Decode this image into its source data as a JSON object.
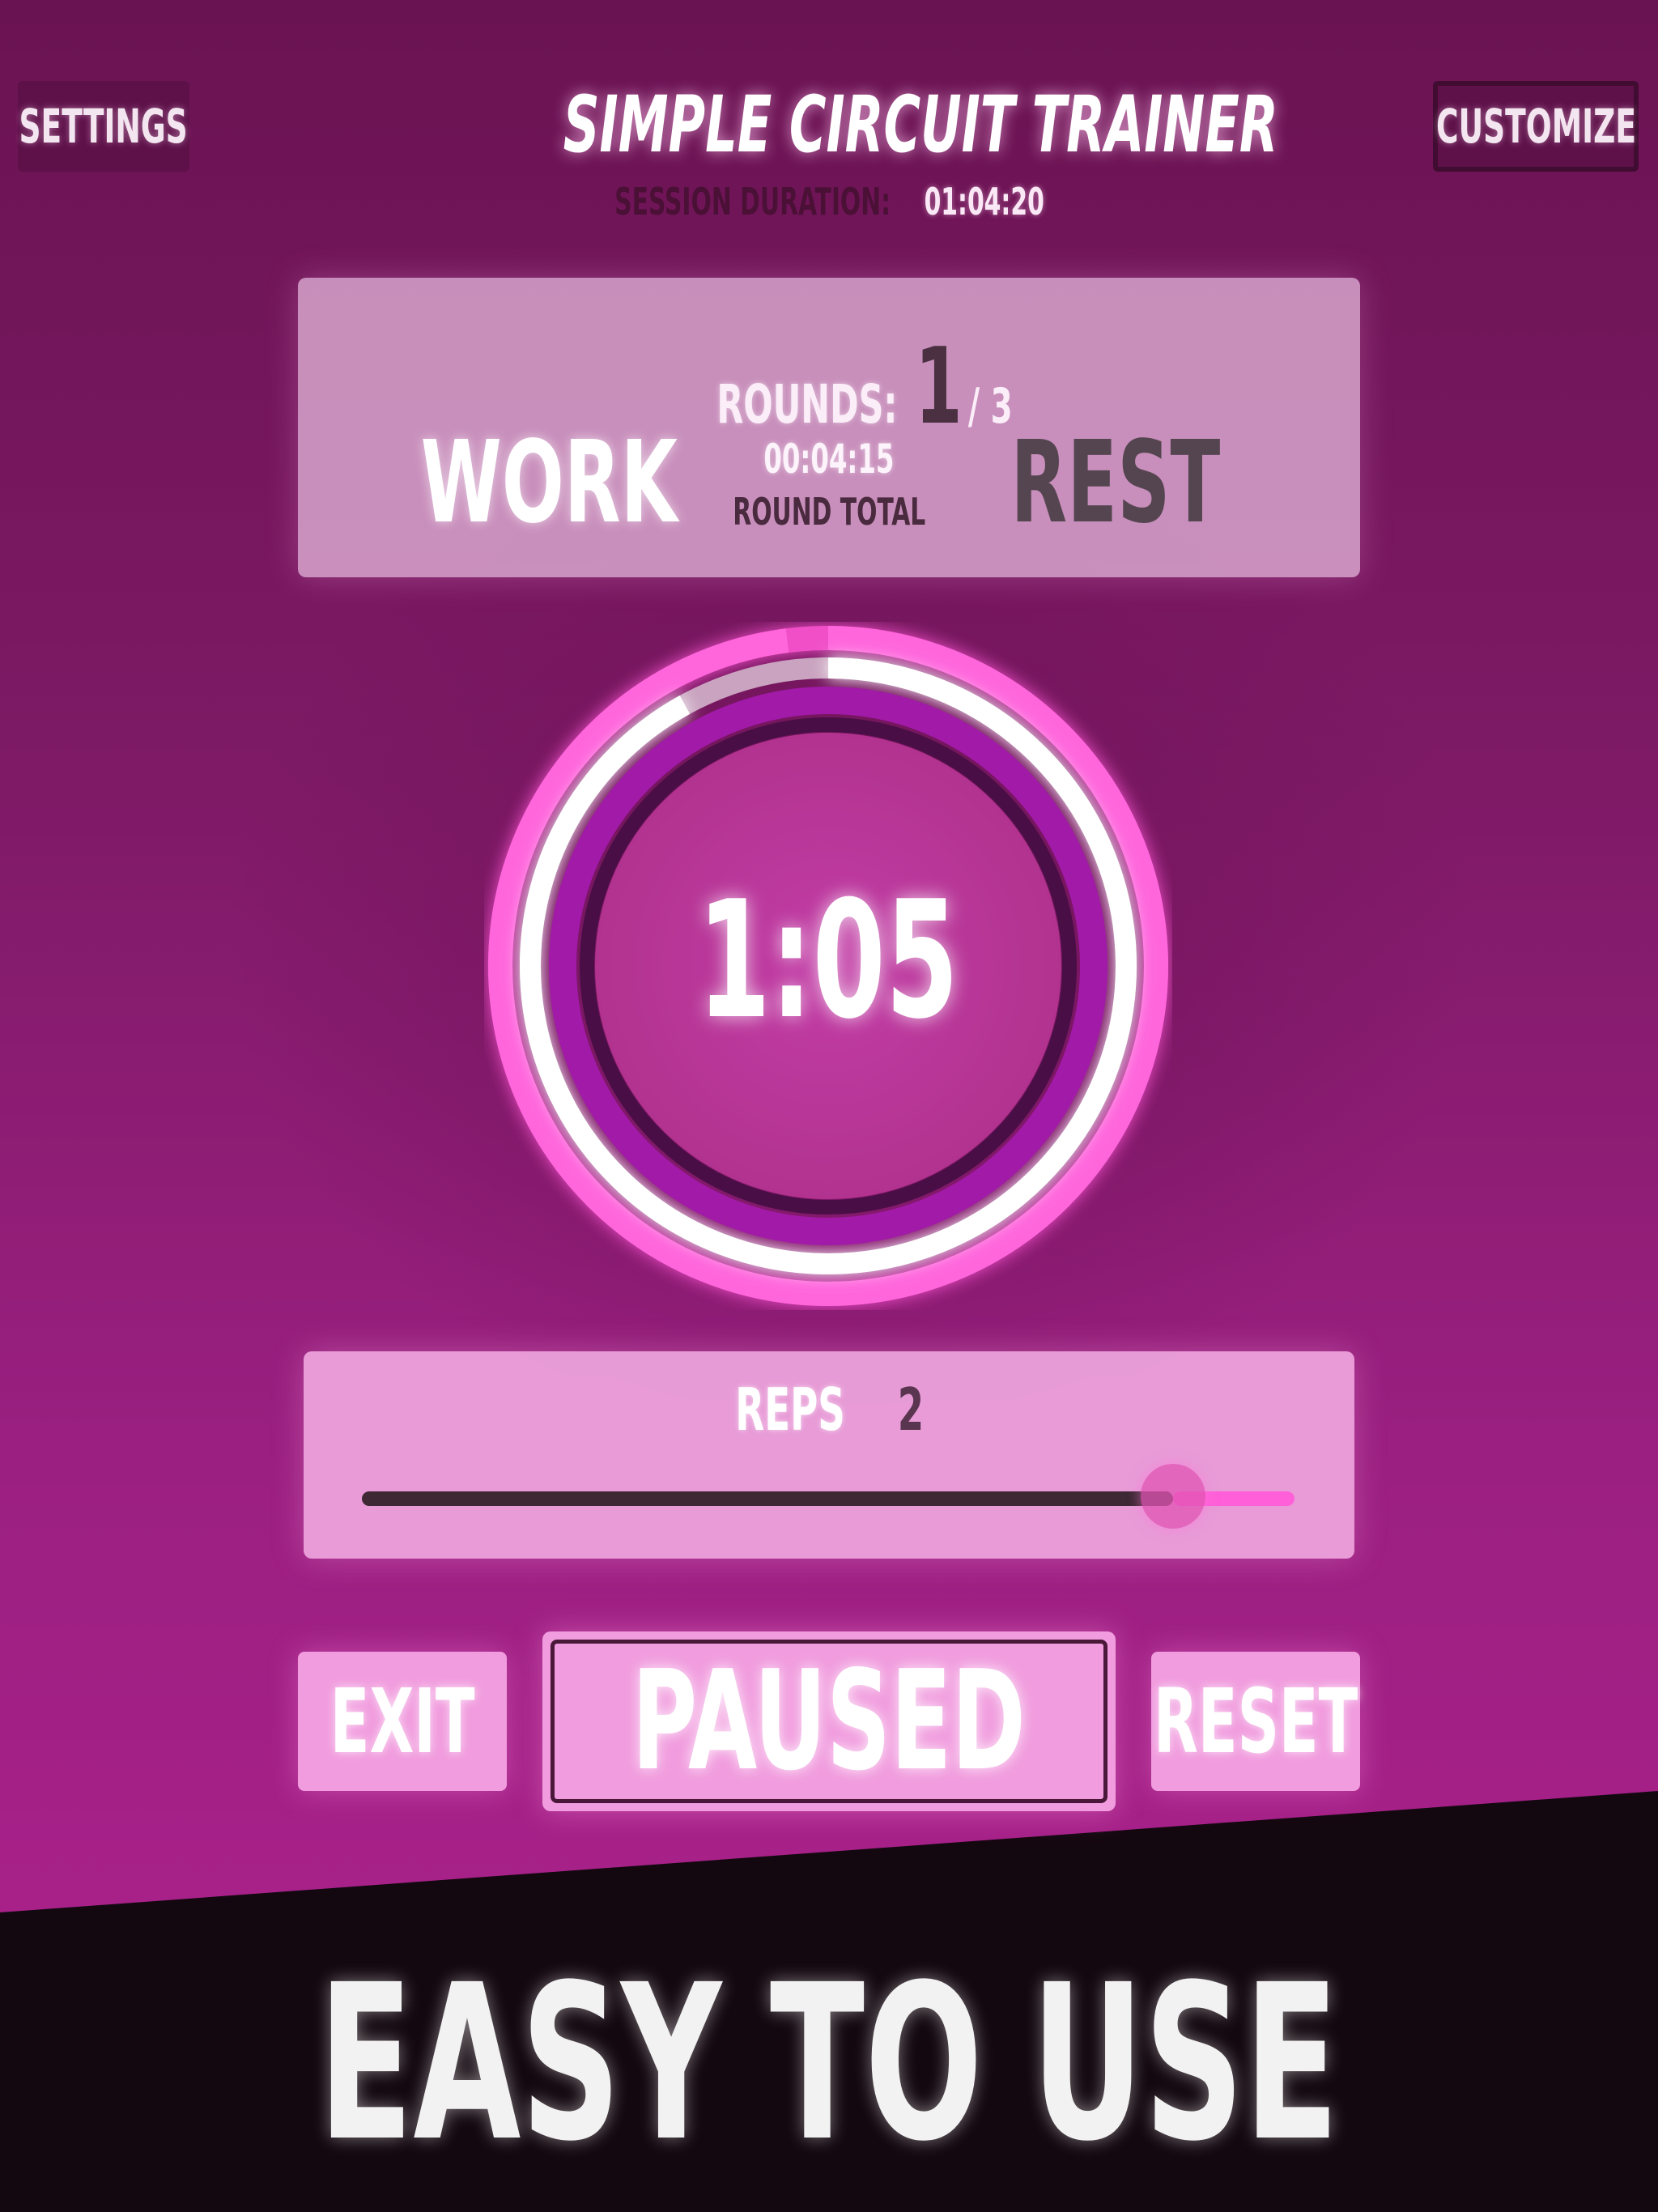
{
  "header": {
    "settings_label": "SETTINGS",
    "customize_label": "CUSTOMIZE",
    "title": "SIMPLE CIRCUIT TRAINER",
    "session_label": "SESSION DURATION:",
    "session_value": "01:04:20"
  },
  "rounds": {
    "label": "ROUNDS:",
    "current": "1",
    "total": "/ 3",
    "work_label": "WORK",
    "rest_label": "REST",
    "round_time": "00:04:15",
    "round_total_label": "ROUND TOTAL"
  },
  "timer": {
    "value": "1:05",
    "outer_progress": 0.98,
    "inner_progress": 0.92
  },
  "reps": {
    "label": "REPS",
    "value": "2",
    "slider_fraction": 0.87
  },
  "controls": {
    "exit_label": "EXIT",
    "paused_label": "PAUSED",
    "reset_label": "RESET"
  },
  "tagline": "EASY TO USE",
  "colors": {
    "accent": "#ff5fd8",
    "inner_ring": "#a01aa8",
    "dark_ring": "#4a0e46"
  }
}
